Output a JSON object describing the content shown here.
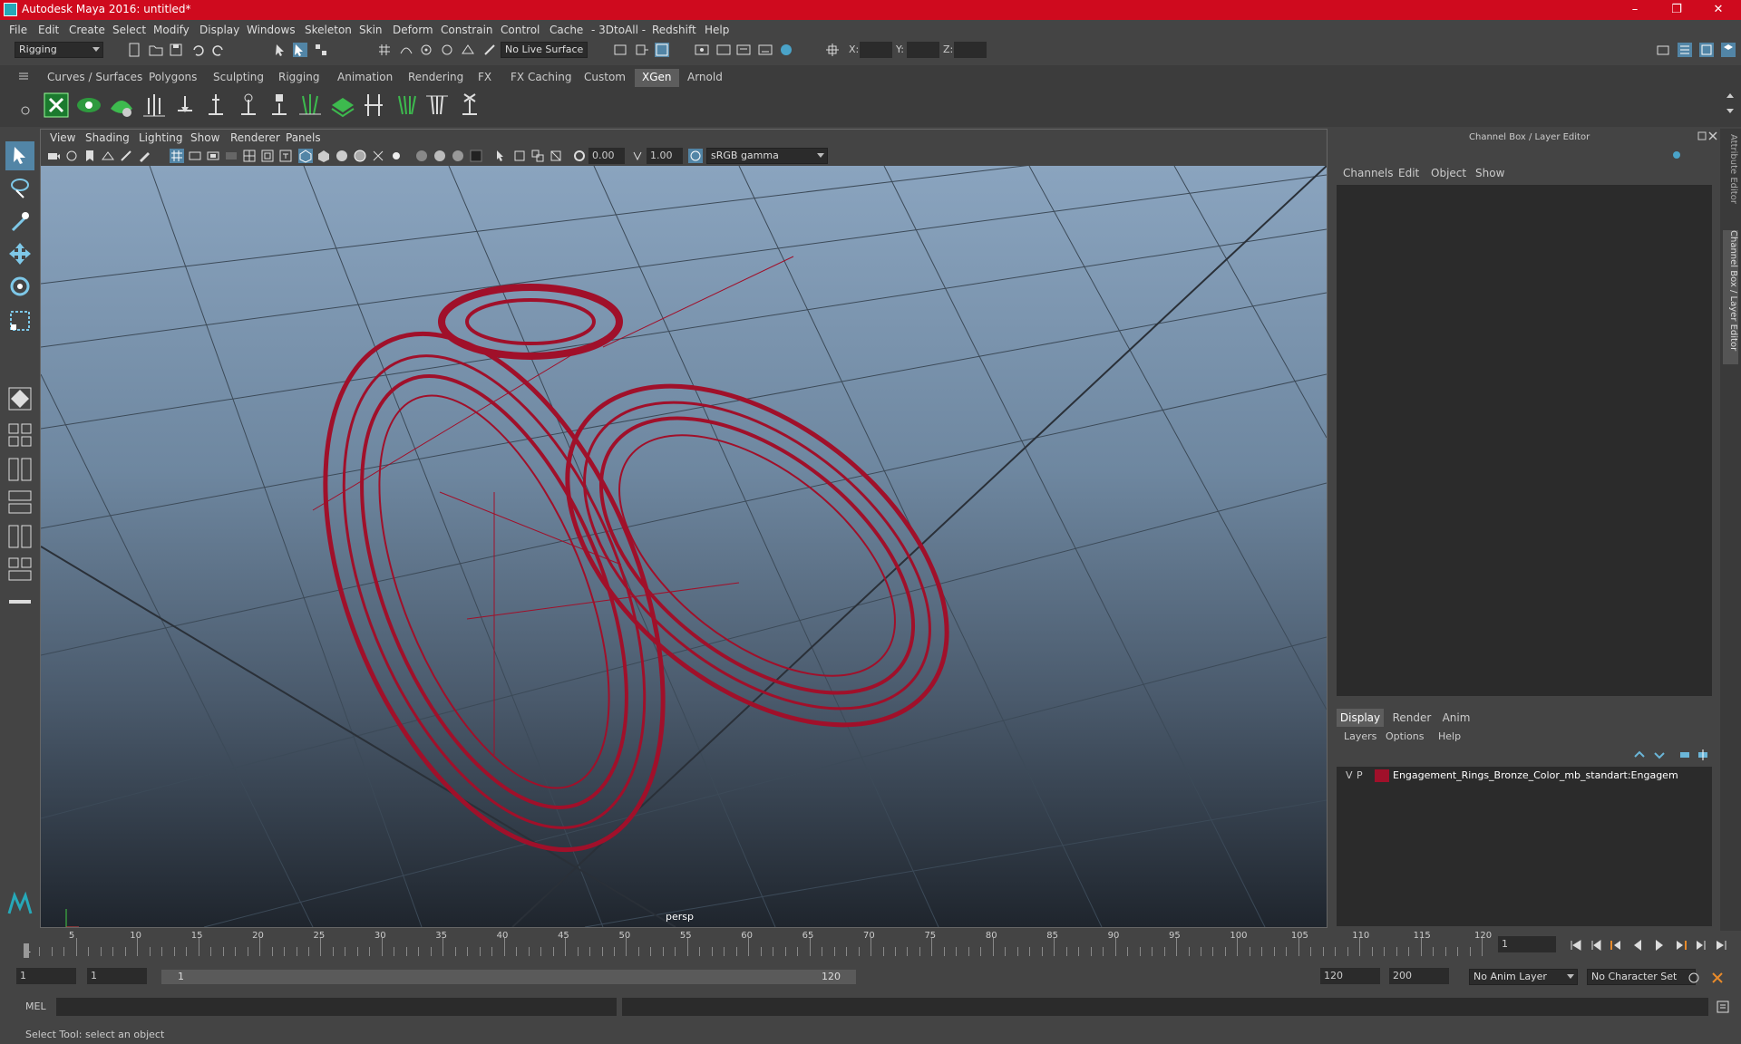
{
  "window": {
    "title": "Autodesk Maya 2016: untitled*",
    "minimize": "–",
    "maximize": "❐",
    "close": "✕"
  },
  "menus": [
    "File",
    "Edit",
    "Create",
    "Select",
    "Modify",
    "Display",
    "Windows",
    "Skeleton",
    "Skin",
    "Deform",
    "Constrain",
    "Control",
    "Cache",
    "- 3DtoAll -",
    "Redshift",
    "Help"
  ],
  "statusline": {
    "mode": "Rigging",
    "live_surface": "No Live Surface",
    "x_label": "X:",
    "y_label": "Y:",
    "z_label": "Z:"
  },
  "shelf_tabs": [
    "Curves / Surfaces",
    "Polygons",
    "Sculpting",
    "Rigging",
    "Animation",
    "Rendering",
    "FX",
    "FX Caching",
    "Custom",
    "XGen",
    "Arnold"
  ],
  "active_shelf": "XGen",
  "viewport": {
    "menus": [
      "View",
      "Shading",
      "Lighting",
      "Show",
      "Renderer",
      "Panels"
    ],
    "exposure": "0.00",
    "gamma": "1.00",
    "color_space": "sRGB gamma",
    "camera_label": "persp"
  },
  "channelbox": {
    "title": "Channel Box / Layer Editor",
    "menus": [
      "Channels",
      "Edit",
      "Object",
      "Show"
    ],
    "tabs": [
      "Display",
      "Render",
      "Anim"
    ],
    "active_tab": "Display",
    "layer_menus": [
      "Layers",
      "Options",
      "Help"
    ],
    "layer": {
      "v": "V",
      "p": "P",
      "name": "Engagement_Rings_Bronze_Color_mb_standart:Engagem",
      "color": "#a0102a"
    }
  },
  "side_tabs": [
    "Attribute Editor",
    "Channel Box / Layer Editor"
  ],
  "timeline": {
    "ticks": [
      "5",
      "10",
      "15",
      "20",
      "25",
      "30",
      "35",
      "40",
      "45",
      "50",
      "55",
      "60",
      "65",
      "70",
      "75",
      "80",
      "85",
      "90",
      "95",
      "100",
      "105",
      "110",
      "115",
      "120"
    ],
    "first_tick": "1",
    "current_frame": "1"
  },
  "range": {
    "start": "1",
    "playback_start": "1",
    "slider_start": "1",
    "slider_end": "120",
    "playback_end": "120",
    "end": "200",
    "anim_layer": "No Anim Layer",
    "character_set": "No Character Set"
  },
  "cmdline": {
    "label": "MEL"
  },
  "helpline": {
    "text": "Select Tool: select an object"
  },
  "colors": {
    "title_bar": "#cf0a1e",
    "wireframe": "#a0102a",
    "active_tab": "#5d5d5d"
  }
}
